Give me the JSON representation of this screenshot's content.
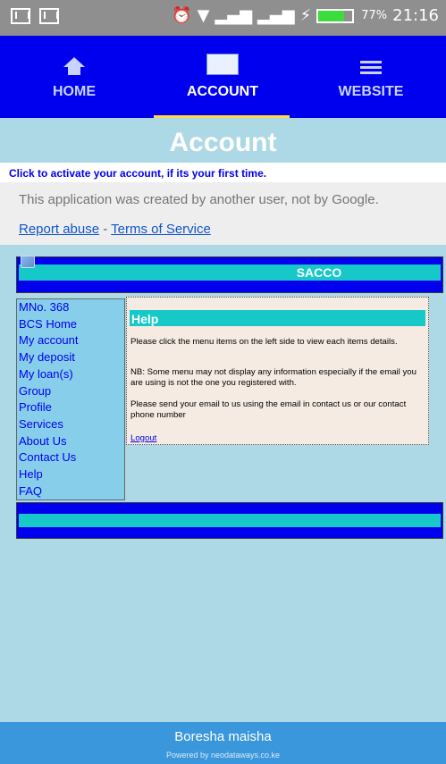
{
  "status_bar": {
    "left_icons": [
      "gmail-icon",
      "gmail-icon"
    ],
    "battery_percent": "77%",
    "time": "21:16"
  },
  "tabs": [
    {
      "label": "HOME",
      "icon": "home-icon"
    },
    {
      "label": "ACCOUNT",
      "icon": "account-logo-icon"
    },
    {
      "label": "WEBSITE",
      "icon": "list-icon"
    }
  ],
  "page_title": "Account",
  "activate_text": "Click to activate your account, if its your first time.",
  "google_banner": {
    "message": "This application was created by another user, not by Google.",
    "report_abuse": "Report abuse",
    "separator": "-",
    "terms": "Terms of Service"
  },
  "sacco_header": {
    "name": "SACCO"
  },
  "left_menu": [
    "MNo. 368",
    "BCS Home",
    "My account",
    "My deposit",
    "My loan(s)",
    "Group",
    "Profile",
    "Services",
    "About Us",
    "Contact Us",
    "Help",
    "FAQ"
  ],
  "help_panel": {
    "heading": "Help",
    "p1": "Please click the menu items on the left side to view each items details.",
    "p2": "NB: Some menu may not display any information especially if the email you are using is not the one you registered with.",
    "p3": "Please send your email to us using the email in contact us or our contact phone number",
    "logout": "Logout"
  },
  "footer": {
    "tagline": "Boresha maisha",
    "powered_by": "Powered by neodataways.co.ke"
  },
  "colors": {
    "tab_bar": "#0000ee",
    "accent_teal": "#16c8c8",
    "page_bg": "#add8e6",
    "bottom_bar": "#3a97dc"
  }
}
